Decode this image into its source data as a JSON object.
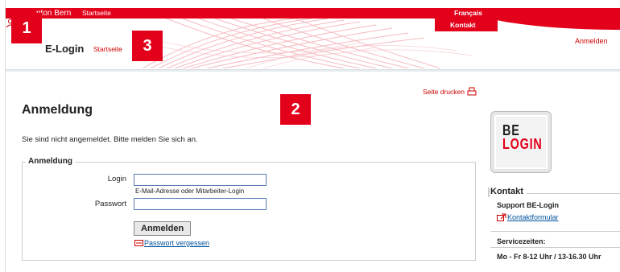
{
  "topbar": {
    "canton": "nton Bern",
    "home": "Startseite",
    "language": "Français"
  },
  "header": {
    "contact": "Kontakt",
    "app_title": "E-Login",
    "app_home": "Startseite",
    "login": "Anmelden"
  },
  "badges": [
    "1",
    "2",
    "3"
  ],
  "main": {
    "print": "Seite drucken",
    "title": "Anmeldung",
    "status": "Sie sind nicht angemeldet. Bitte melden Sie sich an.",
    "form": {
      "legend": "Anmeldung",
      "login_label": "Login",
      "login_value": "",
      "login_hint": "E-Mail-Adresse oder Mitarbeiter-Login",
      "password_label": "Passwort",
      "password_value": "",
      "submit": "Anmelden",
      "forgot": "Passwort vergessen"
    }
  },
  "sidebar": {
    "logo_line1": "BE",
    "logo_line2": "LOGIN",
    "contact_title": "Kontakt",
    "support": "Support BE-Login",
    "contact_form": "Kontaktformular",
    "service_label": "Servicezeiten:",
    "service_hours": "Mo - Fr 8-12 Uhr / 13-16.30 Uhr"
  },
  "colors": {
    "brand_red": "#e2001a",
    "link_blue": "#00529b"
  }
}
